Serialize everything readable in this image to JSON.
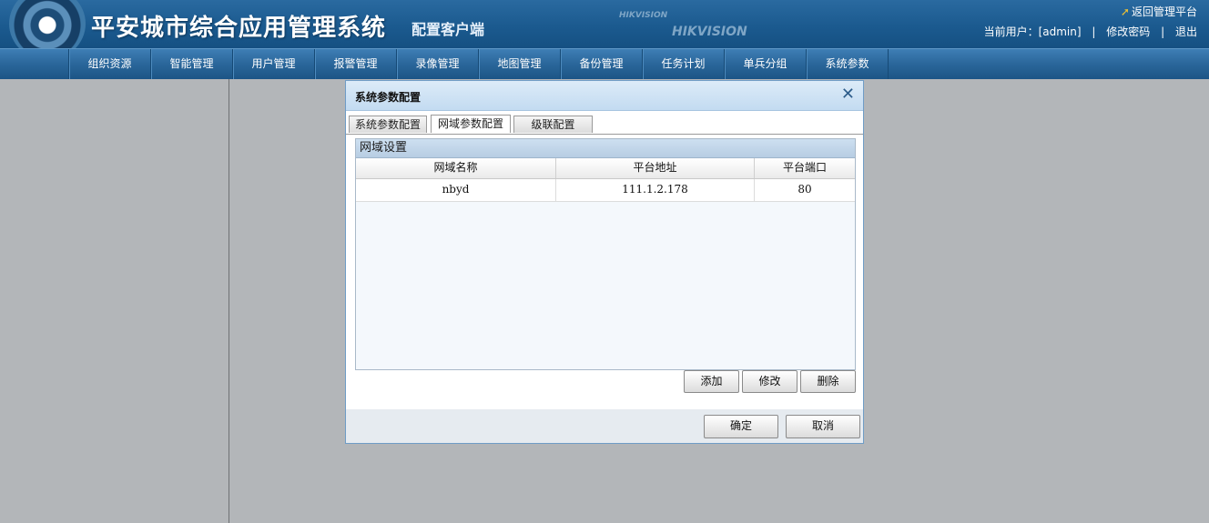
{
  "header": {
    "title": "平安城市综合应用管理系统",
    "subtitle": "配置客户端",
    "brand_small": "HIKVISION",
    "brand_large": "HIKVISION",
    "back_link": "返回管理平台",
    "current_user_label": "当前用户：[admin]",
    "change_password": "修改密码",
    "logout": "退出",
    "separator": "|"
  },
  "menu": {
    "items": [
      {
        "label": "组织资源"
      },
      {
        "label": "智能管理"
      },
      {
        "label": "用户管理"
      },
      {
        "label": "报警管理"
      },
      {
        "label": "录像管理"
      },
      {
        "label": "地图管理"
      },
      {
        "label": "备份管理"
      },
      {
        "label": "任务计划"
      },
      {
        "label": "单兵分组"
      },
      {
        "label": "系统参数"
      }
    ]
  },
  "dialog": {
    "title": "系统参数配置",
    "close_glyph": "✕",
    "tabs": [
      {
        "label": "系统参数配置"
      },
      {
        "label": "网域参数配置"
      },
      {
        "label": "级联配置"
      }
    ],
    "active_tab": 1,
    "group_title": "网域设置",
    "columns": [
      "网域名称",
      "平台地址",
      "平台端口"
    ],
    "rows": [
      [
        "nbyd",
        "111.1.2.178",
        "80"
      ]
    ],
    "buttons": {
      "add": "添加",
      "edit": "修改",
      "delete": "删除",
      "ok": "确定",
      "cancel": "取消"
    }
  },
  "colors": {
    "header_bg": "#1b5a8f",
    "menu_bg": "#2a669a",
    "workspace_bg": "#b3b6b9",
    "dialog_title_bg": "#c3dbf1"
  }
}
